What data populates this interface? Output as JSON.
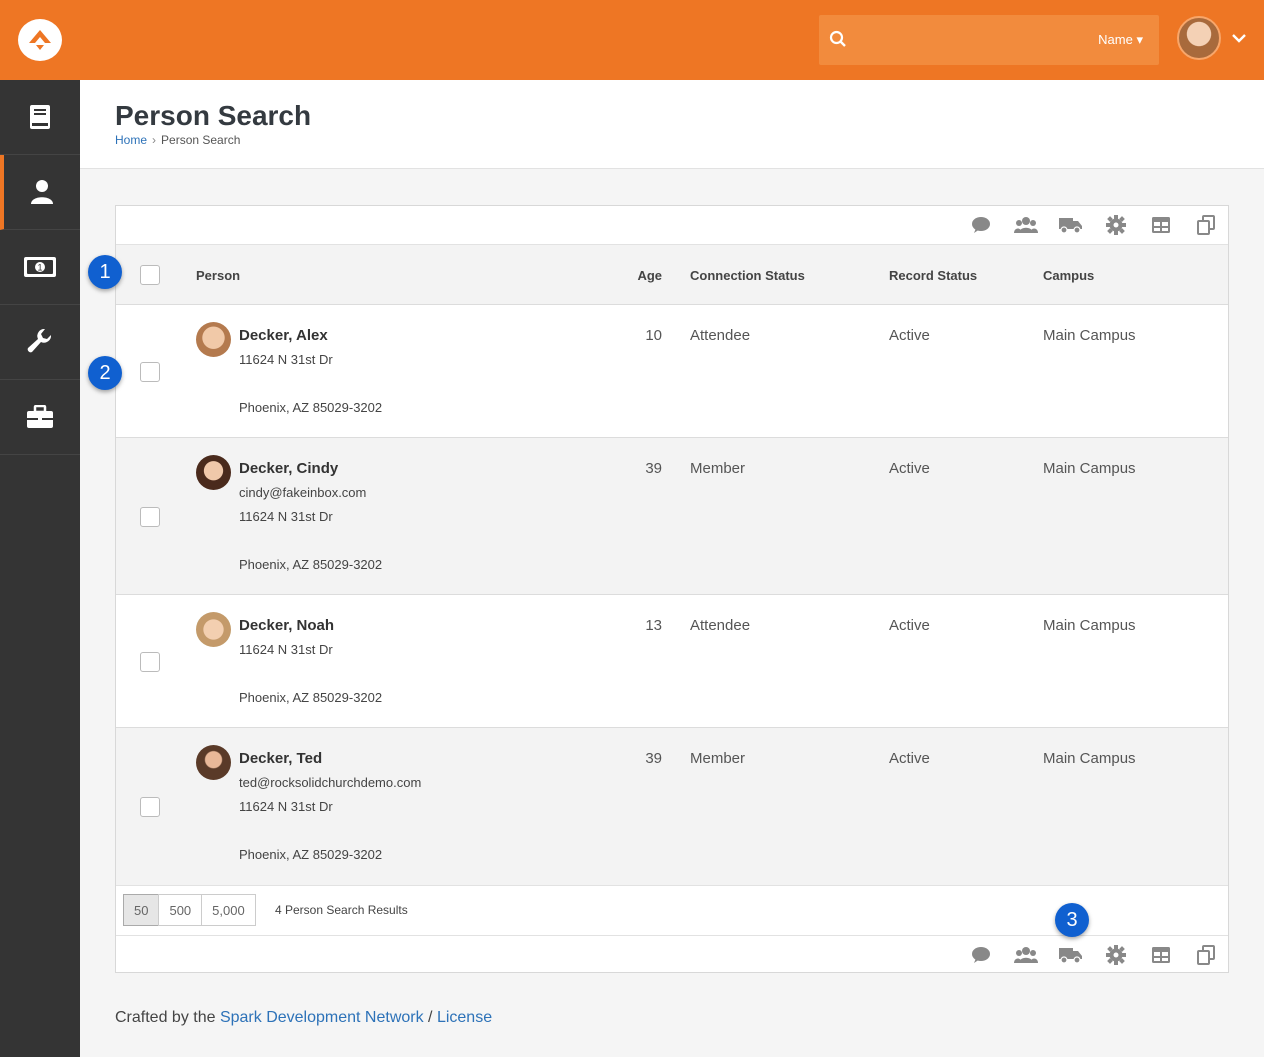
{
  "header": {
    "search_placeholder": "",
    "search_type": "Name ▾",
    "colors": {
      "brand": "#ee7624",
      "sidebar": "#343434",
      "link": "#2d72b8",
      "badge": "#1060d0"
    }
  },
  "sidebar": {
    "items": [
      {
        "icon": "book-icon"
      },
      {
        "icon": "person-icon",
        "active": true
      },
      {
        "icon": "money-icon"
      },
      {
        "icon": "wrench-icon"
      },
      {
        "icon": "briefcase-icon"
      }
    ]
  },
  "page": {
    "title": "Person Search",
    "breadcrumb": {
      "home": "Home",
      "current": "Person Search"
    }
  },
  "grid": {
    "columns": {
      "person": "Person",
      "age": "Age",
      "connection": "Connection Status",
      "record": "Record Status",
      "campus": "Campus"
    },
    "rows": [
      {
        "name": "Decker, Alex",
        "email": "",
        "street": "11624 N 31st Dr",
        "city": "Phoenix, AZ 85029-3202",
        "age": "10",
        "connection": "Attendee",
        "record": "Active",
        "campus": "Main Campus"
      },
      {
        "name": "Decker, Cindy",
        "email": "cindy@fakeinbox.com",
        "street": "11624 N 31st Dr",
        "city": "Phoenix, AZ 85029-3202",
        "age": "39",
        "connection": "Member",
        "record": "Active",
        "campus": "Main Campus"
      },
      {
        "name": "Decker, Noah",
        "email": "",
        "street": "11624 N 31st Dr",
        "city": "Phoenix, AZ 85029-3202",
        "age": "13",
        "connection": "Attendee",
        "record": "Active",
        "campus": "Main Campus"
      },
      {
        "name": "Decker, Ted",
        "email": "ted@rocksolidchurchdemo.com",
        "street": "11624 N 31st Dr",
        "city": "Phoenix, AZ 85029-3202",
        "age": "39",
        "connection": "Member",
        "record": "Active",
        "campus": "Main Campus"
      }
    ],
    "page_sizes": [
      "50",
      "500",
      "5,000"
    ],
    "selected_page_size": "50",
    "result_count": "4 Person Search Results",
    "actions": [
      "comment-icon",
      "users-icon",
      "truck-icon",
      "gear-icon",
      "table-icon",
      "copy-icon"
    ]
  },
  "callouts": [
    "1",
    "2",
    "3"
  ],
  "footer": {
    "prefix": "Crafted by the ",
    "network": "Spark Development Network",
    "sep": " / ",
    "license": "License"
  }
}
